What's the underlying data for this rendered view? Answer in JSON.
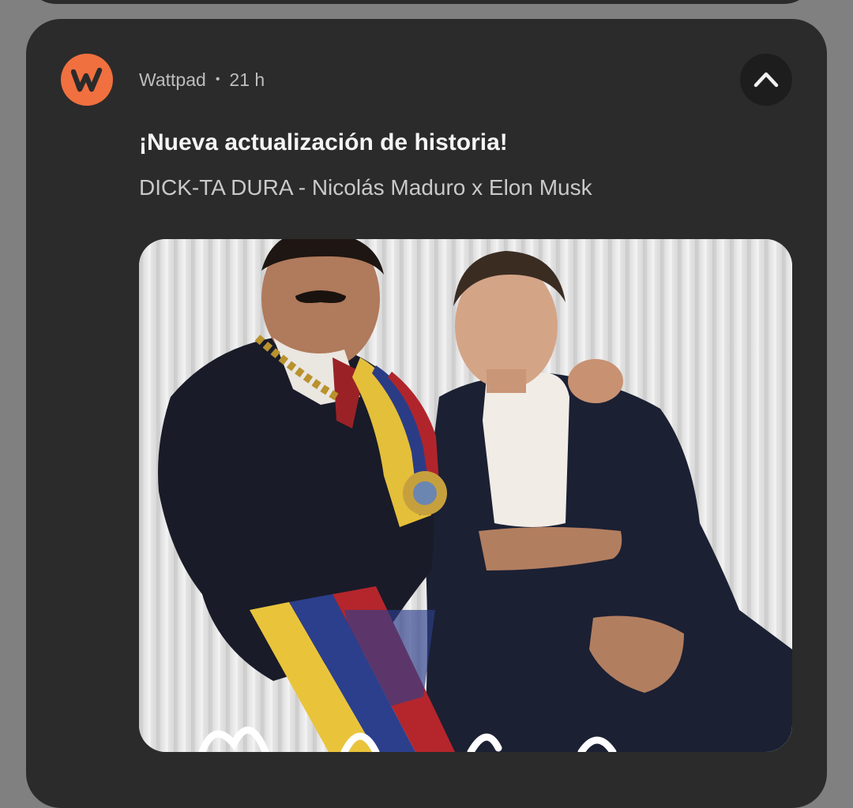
{
  "notification": {
    "app_name": "Wattpad",
    "separator": "•",
    "time_ago": "21 h",
    "title": "¡Nueva actualización de historia!",
    "body": "DICK-TA DURA - Nicolás Maduro x Elon Musk",
    "app_icon": "wattpad-w-icon",
    "collapse_icon": "chevron-up-icon",
    "accent_color": "#f0703f",
    "card_color": "#2b2b2b"
  }
}
